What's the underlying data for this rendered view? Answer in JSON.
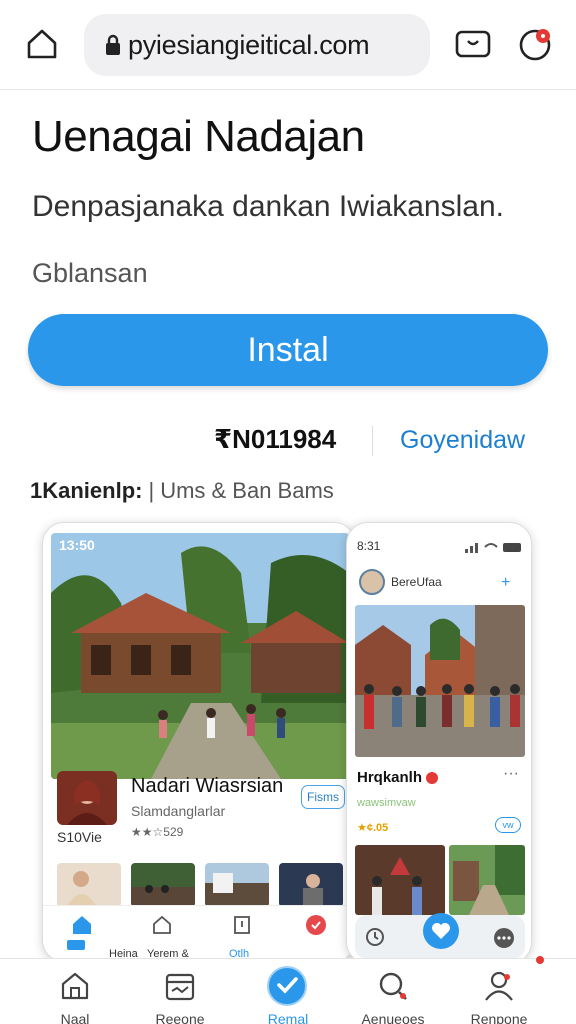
{
  "browser": {
    "url": "pyiesiangieitical.com",
    "home_icon": "home-icon",
    "lock_icon": "lock-icon",
    "tabs_icon": "tabs-icon",
    "profile_icon": "profile-icon"
  },
  "app": {
    "title": "Uenagai Nadajan",
    "subtitle": "Denpasjanaka dankan Iwiakanslan.",
    "category": "Gblansan",
    "install_label": "Instal",
    "code": "₹N011984",
    "developer": "Goyenidaw",
    "meta_key": "1Kanienlp:",
    "meta_sep": "|",
    "meta_value": "Ums & Ban Bams"
  },
  "screenshot1": {
    "status_time": "13:50",
    "card_title": "Nadari Wiasrsian",
    "card_subtitle": "Slamdanglarlar",
    "card_rating": "★★☆529",
    "card_size": "S10Vie",
    "card_button": "Fisms",
    "mini_nav": [
      "Heina",
      "Yerem &",
      "Otlh"
    ]
  },
  "screenshot2": {
    "status_time": "8:31",
    "profile_name": "BereUfaa",
    "title": "Hrqkanlh",
    "subtitle_line": "wawsimvaw",
    "rating": "★¢.05",
    "pill": "vw"
  },
  "bottom_nav": [
    {
      "label": "Naal",
      "icon": "home-icon"
    },
    {
      "label": "Reeone",
      "icon": "calendar-icon"
    },
    {
      "label": "Remal",
      "icon": "heart-check-icon"
    },
    {
      "label": "Aenueoes",
      "icon": "search-icon"
    },
    {
      "label": "Renpone",
      "icon": "person-icon"
    }
  ],
  "colors": {
    "accent": "#2a97ea",
    "link": "#1d7fd1",
    "notification": "#e53935"
  }
}
